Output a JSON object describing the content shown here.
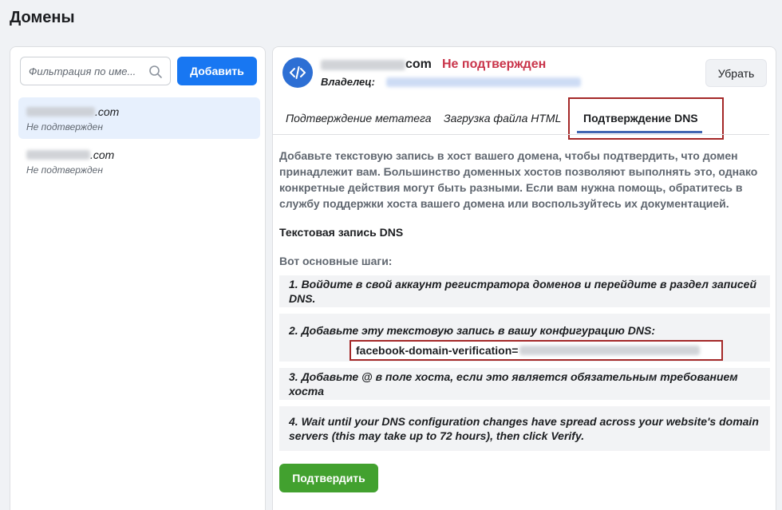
{
  "page": {
    "title": "Домены"
  },
  "sidebar": {
    "search": {
      "placeholder": "Фильтрация по име..."
    },
    "add_label": "Добавить",
    "domains": [
      {
        "suffix": ".com",
        "status": "Не подтвержден"
      },
      {
        "suffix": ".com",
        "status": "Не подтвержден"
      }
    ]
  },
  "header": {
    "domain_suffix": "com",
    "status": "Не подтвержден",
    "owner_label": "Владелец:",
    "remove_label": "Убрать"
  },
  "tabs": [
    {
      "label": "Подтверждение метатега"
    },
    {
      "label": "Загрузка файла HTML"
    },
    {
      "label": "Подтверждение DNS"
    }
  ],
  "content": {
    "intro": "Добавьте текстовую запись в хост вашего домена, чтобы подтвердить, что домен принадлежит вам. Большинство доменных хостов позволяют выполнять это, однако конкретные действия могут быть разными. Если вам нужна помощь, обратитесь в службу поддержки хоста вашего домена или воспользуйтесь их документацией.",
    "section_title": "Текстовая запись DNS",
    "steps_title": "Вот основные шаги:",
    "steps": [
      "1. Войдите в свой аккаунт регистратора доменов и перейдите в раздел записей DNS.",
      "2. Добавьте эту текстовую запись в вашу конфигурацию DNS:",
      "3. Добавьте @ в поле хоста, если это является обязательным требованием хоста",
      "4. Wait until your DNS configuration changes have spread across your website's domain servers (this may take up to 72 hours), then click Verify."
    ],
    "record_prefix": "facebook-domain-verification=",
    "confirm_label": "Подтвердить"
  },
  "colors": {
    "primary": "#1877f2",
    "unverified": "#c9344a",
    "confirm": "#42a12f",
    "highlight_border": "#a42828"
  }
}
